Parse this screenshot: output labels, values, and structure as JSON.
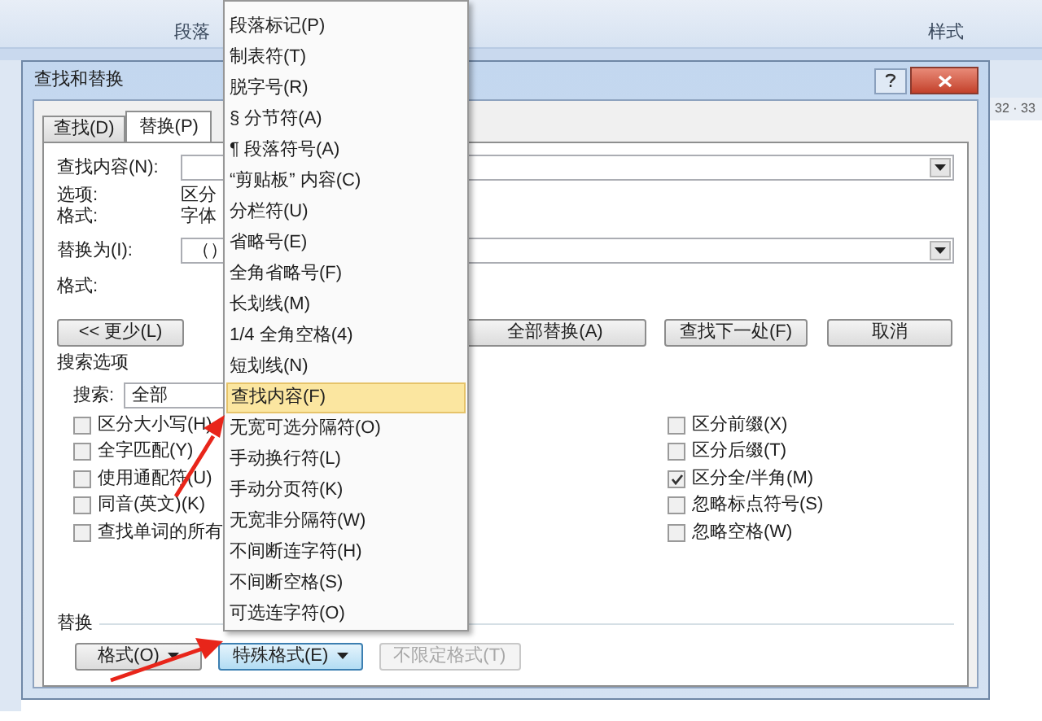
{
  "ribbon": {
    "groups": [
      "段落",
      "样式"
    ]
  },
  "ruler": {
    "text": "32 · 33"
  },
  "dialog": {
    "title": "查找和替换",
    "tabs": [
      {
        "label": "查找(D)",
        "selected": false
      },
      {
        "label": "替换(P)",
        "selected": true
      }
    ],
    "find": {
      "label": "查找内容(N):"
    },
    "find_options": {
      "label": "选项:",
      "value": "区分"
    },
    "find_format": {
      "label": "格式:",
      "value": "字体"
    },
    "replace": {
      "label": "替换为(I):",
      "value": "（）"
    },
    "replace_format": {
      "label": "格式:"
    },
    "buttons": [
      {
        "label": "<< 更少(L)"
      },
      {
        "label": "全部替换(A)"
      },
      {
        "label": "查找下一处(F)"
      },
      {
        "label": "取消"
      }
    ],
    "search_options": {
      "title": "搜索选项",
      "search_label": "搜索:",
      "search_value": "全部",
      "left": [
        {
          "label": "区分大小写(H)",
          "checked": false
        },
        {
          "label": "全字匹配(Y)",
          "checked": false
        },
        {
          "label": "使用通配符(U)",
          "checked": false
        },
        {
          "label": "同音(英文)(K)",
          "checked": false
        },
        {
          "label": "查找单词的所有",
          "checked": false
        }
      ],
      "right": [
        {
          "label": "区分前缀(X)",
          "checked": false
        },
        {
          "label": "区分后缀(T)",
          "checked": false
        },
        {
          "label": "区分全/半角(M)",
          "checked": true
        },
        {
          "label": "忽略标点符号(S)",
          "checked": false
        },
        {
          "label": "忽略空格(W)",
          "checked": false
        }
      ]
    },
    "replace_section": {
      "title": "替换",
      "buttons": [
        {
          "label": "格式(O)",
          "pressed": false,
          "disabled": false
        },
        {
          "label": "特殊格式(E)",
          "pressed": true,
          "disabled": false
        },
        {
          "label": "不限定格式(T)",
          "pressed": false,
          "disabled": true
        }
      ]
    }
  },
  "special_menu": {
    "items": [
      {
        "label": "段落标记(P)",
        "selected": false
      },
      {
        "label": "制表符(T)",
        "selected": false
      },
      {
        "label": "脱字号(R)",
        "selected": false
      },
      {
        "label": "§ 分节符(A)",
        "selected": false
      },
      {
        "label": "¶ 段落符号(A)",
        "selected": false
      },
      {
        "label": "“剪贴板” 内容(C)",
        "selected": false
      },
      {
        "label": "分栏符(U)",
        "selected": false
      },
      {
        "label": "省略号(E)",
        "selected": false
      },
      {
        "label": "全角省略号(F)",
        "selected": false
      },
      {
        "label": "长划线(M)",
        "selected": false
      },
      {
        "label": "1/4 全角空格(4)",
        "selected": false
      },
      {
        "label": "短划线(N)",
        "selected": false
      },
      {
        "label": "查找内容(F)",
        "selected": true
      },
      {
        "label": "无宽可选分隔符(O)",
        "selected": false
      },
      {
        "label": "手动换行符(L)",
        "selected": false
      },
      {
        "label": "手动分页符(K)",
        "selected": false
      },
      {
        "label": "无宽非分隔符(W)",
        "selected": false
      },
      {
        "label": "不间断连字符(H)",
        "selected": false
      },
      {
        "label": "不间断空格(S)",
        "selected": false
      },
      {
        "label": "可选连字符(O)",
        "selected": false
      }
    ]
  }
}
